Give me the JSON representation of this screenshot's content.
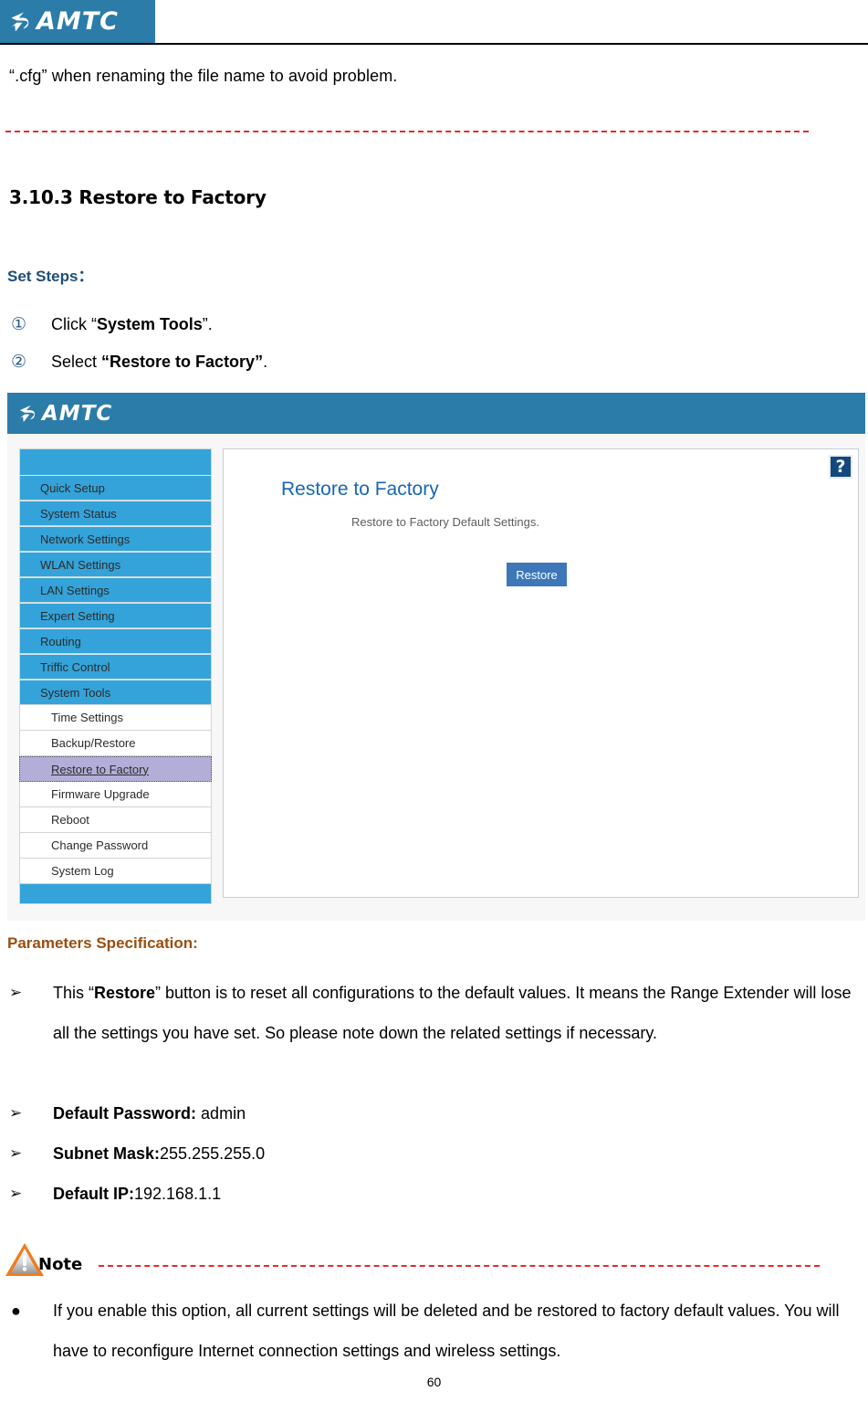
{
  "header": {
    "brand": "AMTC",
    "logo_icon": "amtc-swoosh-logo",
    "brand_color": "#2c7ca9"
  },
  "document": {
    "intro_line": "“.cfg” when renaming the file name to avoid problem.",
    "section_number_title": "3.10.3 Restore to Factory",
    "set_steps_label": "Set Steps：",
    "steps": [
      {
        "marker": "①",
        "prefix": "Click “",
        "bold": "System Tools",
        "suffix": "”."
      },
      {
        "marker": "②",
        "prefix": "Select ",
        "bold": "“Restore to Factory”",
        "suffix": "."
      }
    ],
    "params_heading": "Parameters Specification:",
    "params": [
      {
        "marker": "➢",
        "lead": "This “",
        "bold": "Restore",
        "rest": "” button is to reset all configurations to the default values. It means the Range Extender will lose all the settings you have set. So please note down the related settings if necessary."
      },
      {
        "marker": "➢",
        "bold": "Default Password:",
        "rest": " admin"
      },
      {
        "marker": "➢",
        "bold": "Subnet Mask:",
        "rest": "255.255.255.0"
      },
      {
        "marker": "➢",
        "bold": "Default IP:",
        "rest": "192.168.1.1"
      }
    ],
    "note": {
      "icon": "warning-triangle-icon",
      "label": "Note",
      "bullet_marker": "●",
      "text": "If you enable this option, all current settings will be deleted and be restored to factory default values. You will have to reconfigure Internet connection settings and wireless settings."
    },
    "page_number": "60",
    "divider_color": "#e8292a"
  },
  "embedded_screenshot": {
    "header_brand": "AMTC",
    "header_logo_icon": "amtc-swoosh-logo",
    "sidebar": {
      "items": [
        {
          "label": "Quick Setup",
          "level": "top",
          "state": "normal"
        },
        {
          "label": "System Status",
          "level": "top",
          "state": "normal"
        },
        {
          "label": "Network Settings",
          "level": "top",
          "state": "normal"
        },
        {
          "label": "WLAN Settings",
          "level": "top",
          "state": "normal"
        },
        {
          "label": "LAN Settings",
          "level": "top",
          "state": "normal"
        },
        {
          "label": "Expert Setting",
          "level": "top",
          "state": "normal"
        },
        {
          "label": "Routing",
          "level": "top",
          "state": "normal"
        },
        {
          "label": "Triffic Control",
          "level": "top",
          "state": "normal"
        },
        {
          "label": "System Tools",
          "level": "top",
          "state": "expanded"
        },
        {
          "label": "Time Settings",
          "level": "sub",
          "state": "normal"
        },
        {
          "label": "Backup/Restore",
          "level": "sub",
          "state": "normal"
        },
        {
          "label": "Restore to Factory",
          "level": "sub",
          "state": "selected"
        },
        {
          "label": "Firmware Upgrade",
          "level": "sub",
          "state": "normal"
        },
        {
          "label": "Reboot",
          "level": "sub",
          "state": "normal"
        },
        {
          "label": "Change Password",
          "level": "sub",
          "state": "normal"
        },
        {
          "label": "System Log",
          "level": "sub",
          "state": "normal"
        }
      ],
      "active_color": "#b3aed8",
      "menu_color": "#34a3d9"
    },
    "content": {
      "help_icon": "?",
      "title": "Restore to Factory",
      "description": "Restore to Factory Default Settings.",
      "restore_button": "Restore",
      "button_color": "#3d77b8",
      "title_color": "#1767b3"
    }
  }
}
